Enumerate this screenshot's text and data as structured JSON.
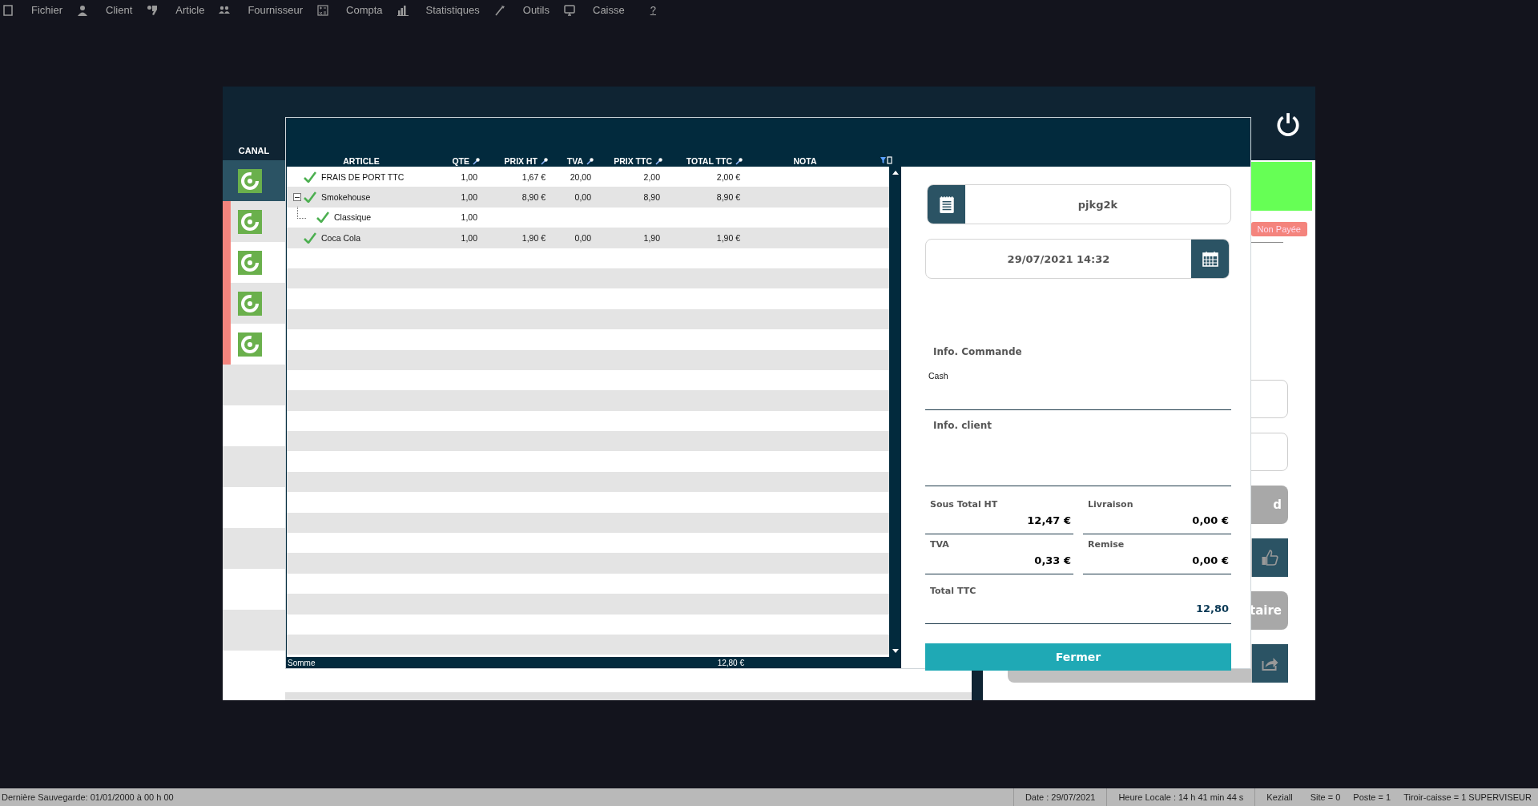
{
  "menu": [
    {
      "label": "Fichier"
    },
    {
      "label": "Client"
    },
    {
      "label": "Article"
    },
    {
      "label": "Fournisseur"
    },
    {
      "label": "Compta"
    },
    {
      "label": "Statistiques"
    },
    {
      "label": "Outils"
    },
    {
      "label": "Caisse"
    },
    {
      "label": "?"
    }
  ],
  "background_window": {
    "canal_label": "CANAL",
    "canal_items": [
      {
        "selected": true,
        "alert": false
      },
      {
        "selected": false,
        "alert": true
      },
      {
        "selected": false,
        "alert": true
      },
      {
        "selected": false,
        "alert": true
      },
      {
        "selected": false,
        "alert": true
      }
    ],
    "status_badge": "Non Payée",
    "buttons": [
      {
        "kind": "field"
      },
      {
        "kind": "field"
      },
      {
        "kind": "grey",
        "label": "d"
      },
      {
        "kind": "thumb"
      },
      {
        "kind": "grey",
        "label": "taire"
      },
      {
        "kind": "share"
      }
    ]
  },
  "dialog": {
    "table": {
      "columns": [
        {
          "label": "ARTICLE",
          "filter": false
        },
        {
          "label": "QTE",
          "filter": true
        },
        {
          "label": "PRIX HT",
          "filter": true
        },
        {
          "label": "TVA",
          "filter": true
        },
        {
          "label": "PRIX TTC",
          "filter": true
        },
        {
          "label": "TOTAL TTC",
          "filter": true
        },
        {
          "label": "NOTA",
          "filter": false
        }
      ],
      "rows": [
        {
          "checked": true,
          "cells": [
            "FRAIS DE PORT TTC",
            "1,00",
            "1,67 €",
            "20,00",
            "2,00",
            "2,00 €"
          ]
        },
        {
          "checked": true,
          "expanded": true,
          "cells": [
            "Smokehouse",
            "1,00",
            "8,90 €",
            "0,00",
            "8,90",
            "8,90 €"
          ],
          "children": [
            {
              "checked": true,
              "cells": [
                "Classique",
                "1,00",
                "",
                "",
                "",
                ""
              ]
            }
          ]
        },
        {
          "checked": true,
          "cells": [
            "Coca Cola",
            "1,00",
            "1,90 €",
            "0,00",
            "1,90",
            "1,90 €"
          ]
        }
      ],
      "footer": {
        "label": "Somme",
        "total": "12,80 €"
      }
    },
    "order_ref": "pjkg2k",
    "datetime": "29/07/2021 14:32",
    "info_commande": {
      "label": "Info. Commande",
      "value": "Cash"
    },
    "info_client": {
      "label": "Info. client"
    },
    "totals": [
      {
        "label": "Sous Total HT",
        "value": "12,47 €"
      },
      {
        "label": "Livraison",
        "value": "0,00 €"
      },
      {
        "label": "TVA",
        "value": "0,33 €"
      },
      {
        "label": "Remise",
        "value": "0,00 €"
      }
    ],
    "total_ttc": {
      "label": "Total TTC",
      "value": "12,80"
    },
    "close_button": "Fermer"
  },
  "status_bar": {
    "left": "Dernière Sauvegarde: 01/01/2000 à 00 h 00",
    "items": [
      "Date : 29/07/2021",
      "Heure Locale : 14 h 41 min 44 s",
      "Keziall",
      "Site = 0",
      "Poste = 1",
      "Tiroir-caisse = 1 SUPERVISEUR"
    ]
  }
}
